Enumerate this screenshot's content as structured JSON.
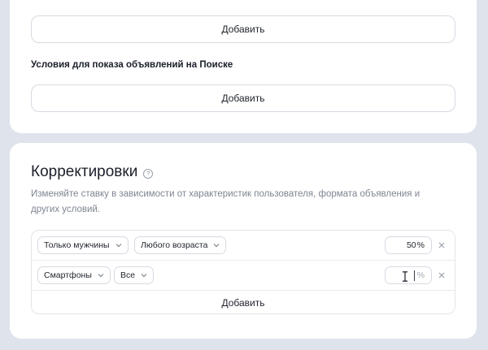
{
  "top_card": {
    "add_label_1": "Добавить",
    "search_conditions_label": "Условия для показа объявлений на Поиске",
    "add_label_2": "Добавить"
  },
  "adjustments": {
    "title": "Корректировки",
    "help_icon": "question-circle-icon",
    "description": "Изменяйте ставку в зависимости от характеристик пользователя, формата объявления и других условий.",
    "rows": [
      {
        "select_1": "Только мужчины",
        "select_2": "Любого возраста",
        "percent_value": "50",
        "percent_suffix": "%"
      },
      {
        "select_1": "Смартфоны",
        "select_2": "Все",
        "percent_value": "",
        "percent_suffix": "%"
      }
    ],
    "add_label": "Добавить"
  },
  "colors": {
    "page_background": "#dfe4ec",
    "card_background": "#ffffff",
    "border": "#d6dae2",
    "text_primary": "#1b1f2a",
    "text_secondary": "#7f8591"
  }
}
